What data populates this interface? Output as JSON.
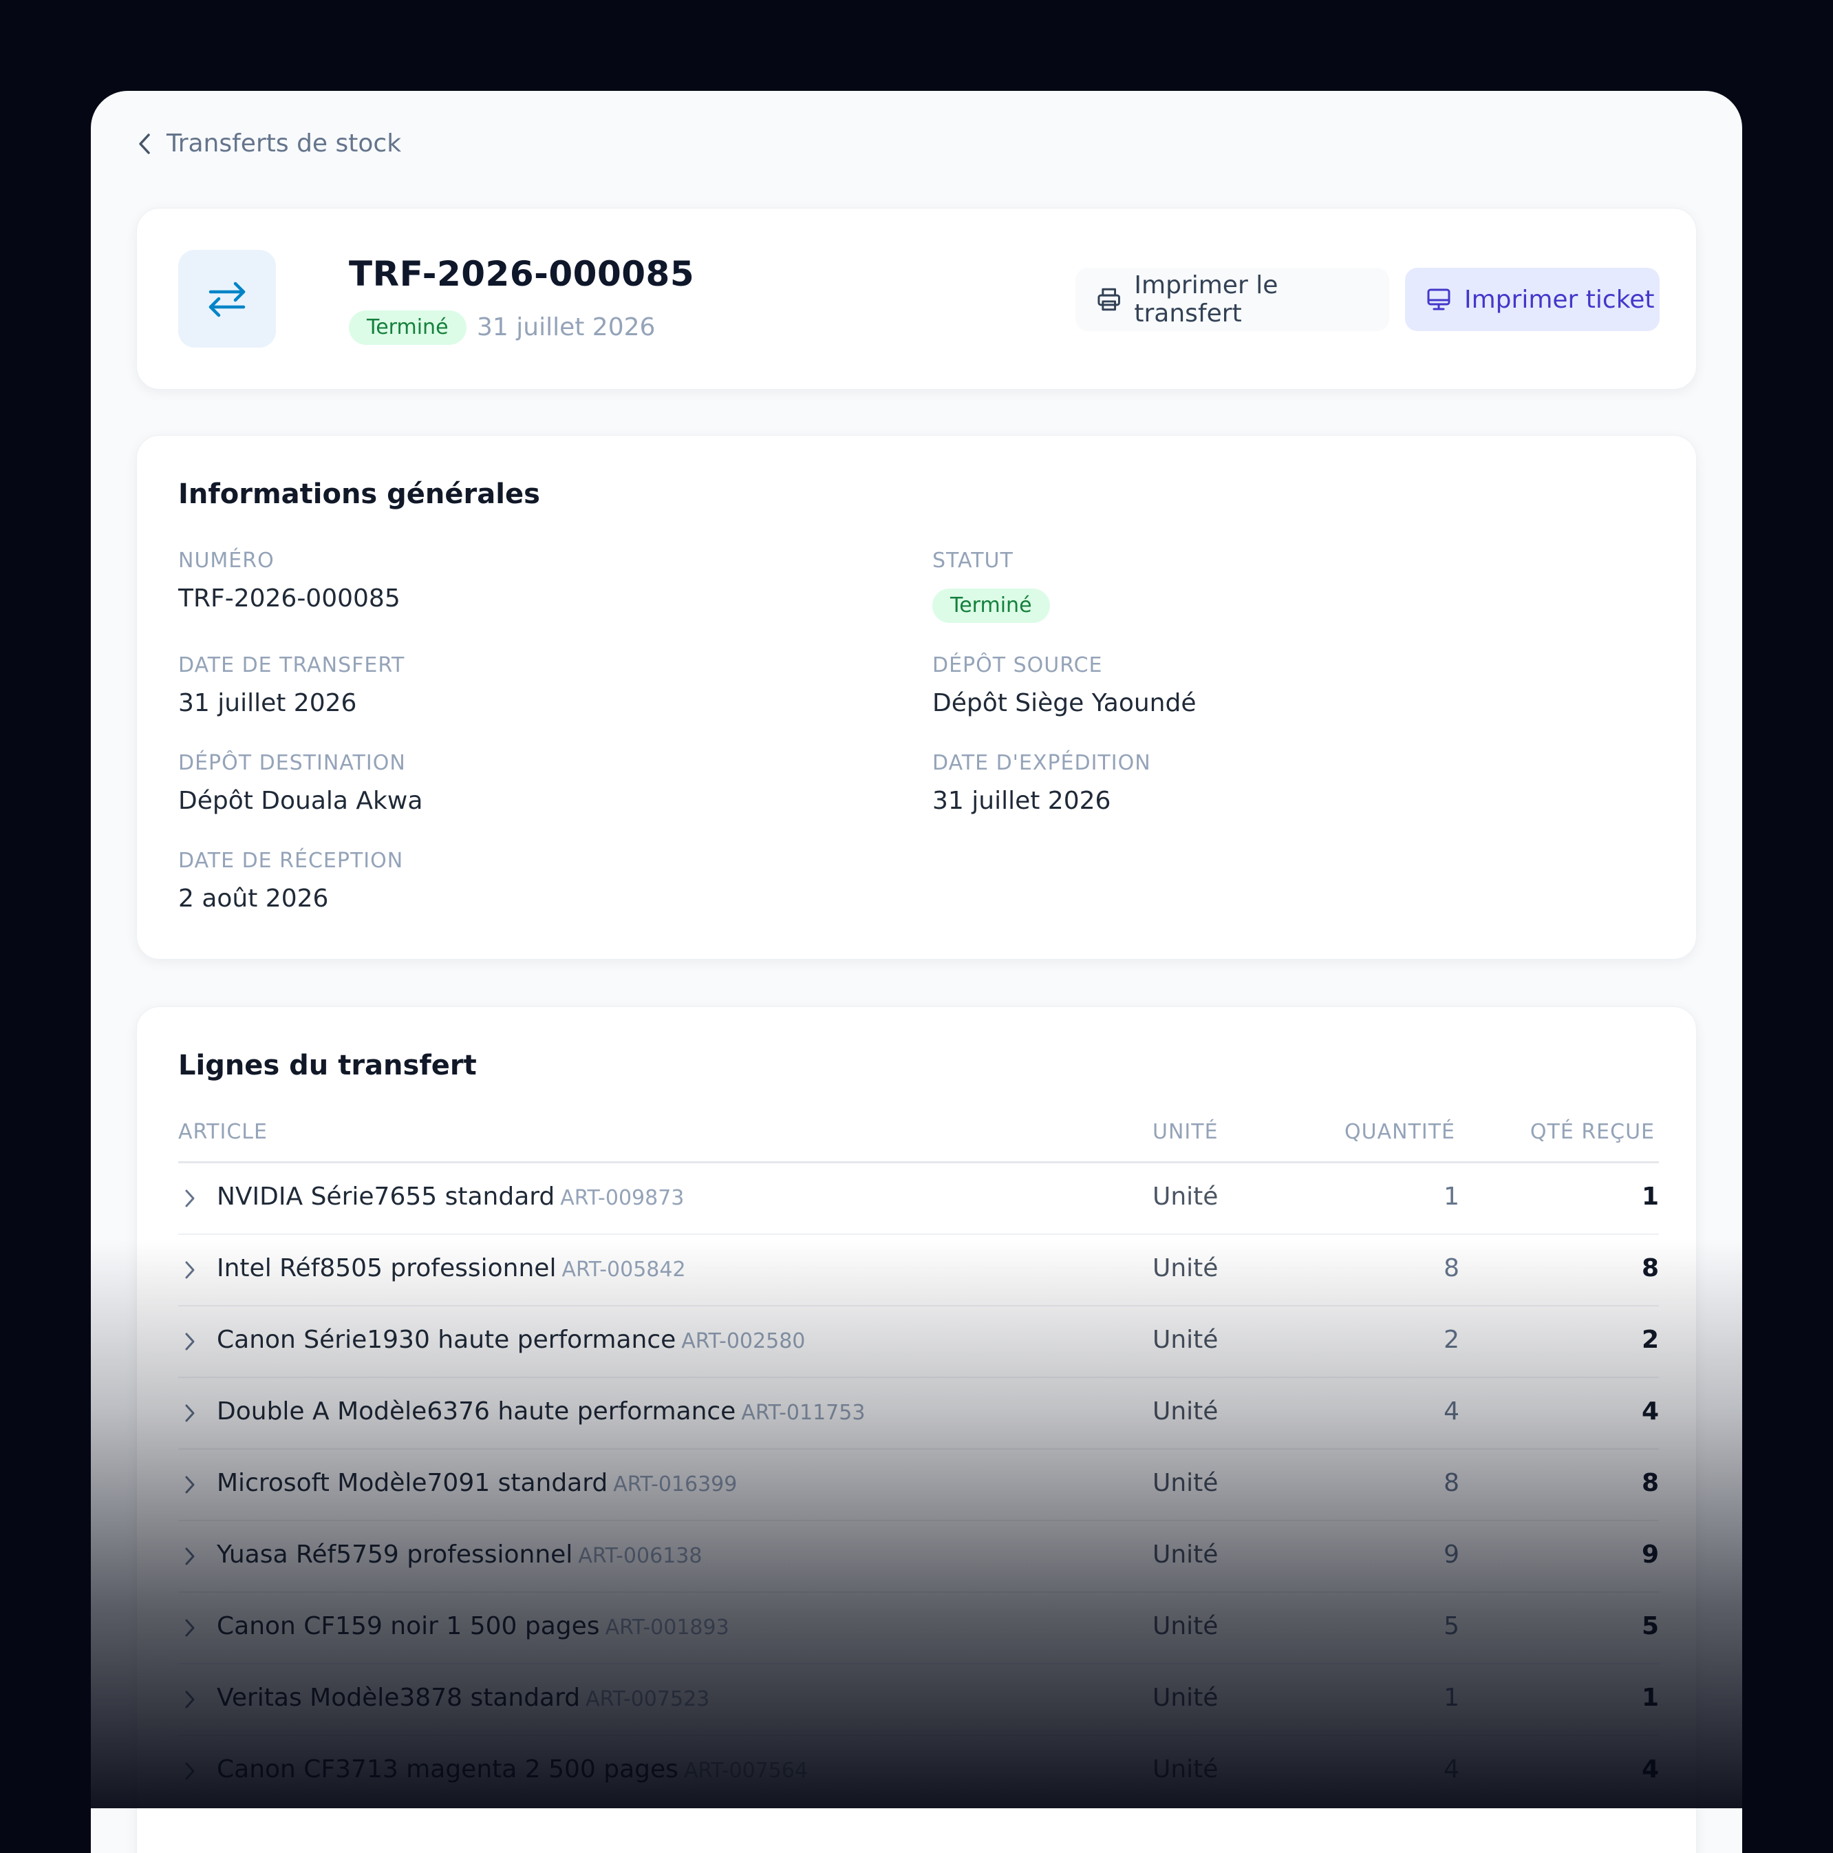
{
  "breadcrumb": {
    "label": "Transferts de stock"
  },
  "header": {
    "title": "TRF-2026-000085",
    "status": "Terminé",
    "date": "31 juillet 2026",
    "print_transfer_label": "Imprimer le transfert",
    "print_ticket_label": "Imprimer ticket"
  },
  "info": {
    "title": "Informations générales",
    "numero_label": "NUMÉRO",
    "numero_value": "TRF-2026-000085",
    "statut_label": "STATUT",
    "statut_value": "Terminé",
    "date_transfert_label": "DATE DE TRANSFERT",
    "date_transfert_value": "31 juillet 2026",
    "depot_source_label": "DÉPÔT SOURCE",
    "depot_source_value": "Dépôt Siège Yaoundé",
    "depot_dest_label": "DÉPÔT DESTINATION",
    "depot_dest_value": "Dépôt Douala Akwa",
    "date_expedition_label": "DATE D'EXPÉDITION",
    "date_expedition_value": "31 juillet 2026",
    "date_reception_label": "DATE DE RÉCEPTION",
    "date_reception_value": "2 août 2026"
  },
  "lines": {
    "title": "Lignes du transfert",
    "columns": {
      "article": "ARTICLE",
      "unite": "UNITÉ",
      "quantite": "QUANTITÉ",
      "qte_recue": "QTÉ REÇUE"
    },
    "rows": [
      {
        "name": "NVIDIA Série7655 standard",
        "code": "ART-009873",
        "unit": "Unité",
        "qty": "1",
        "received": "1"
      },
      {
        "name": "Intel Réf8505 professionnel",
        "code": "ART-005842",
        "unit": "Unité",
        "qty": "8",
        "received": "8"
      },
      {
        "name": "Canon Série1930 haute performance",
        "code": "ART-002580",
        "unit": "Unité",
        "qty": "2",
        "received": "2"
      },
      {
        "name": "Double A Modèle6376 haute performance",
        "code": "ART-011753",
        "unit": "Unité",
        "qty": "4",
        "received": "4"
      },
      {
        "name": "Microsoft Modèle7091 standard",
        "code": "ART-016399",
        "unit": "Unité",
        "qty": "8",
        "received": "8"
      },
      {
        "name": "Yuasa Réf5759 professionnel",
        "code": "ART-006138",
        "unit": "Unité",
        "qty": "9",
        "received": "9"
      },
      {
        "name": "Canon CF159 noir 1 500 pages",
        "code": "ART-001893",
        "unit": "Unité",
        "qty": "5",
        "received": "5"
      },
      {
        "name": "Veritas Modèle3878 standard",
        "code": "ART-007523",
        "unit": "Unité",
        "qty": "1",
        "received": "1"
      },
      {
        "name": "Canon CF3713 magenta 2 500 pages",
        "code": "ART-007564",
        "unit": "Unité",
        "qty": "4",
        "received": "4"
      }
    ]
  },
  "colors": {
    "accent_blue": "#0284c7",
    "badge_green_bg": "#dcfce7",
    "badge_green_text": "#15803d",
    "ticket_button_bg": "#e6eafe",
    "ticket_button_text": "#4338ca"
  }
}
